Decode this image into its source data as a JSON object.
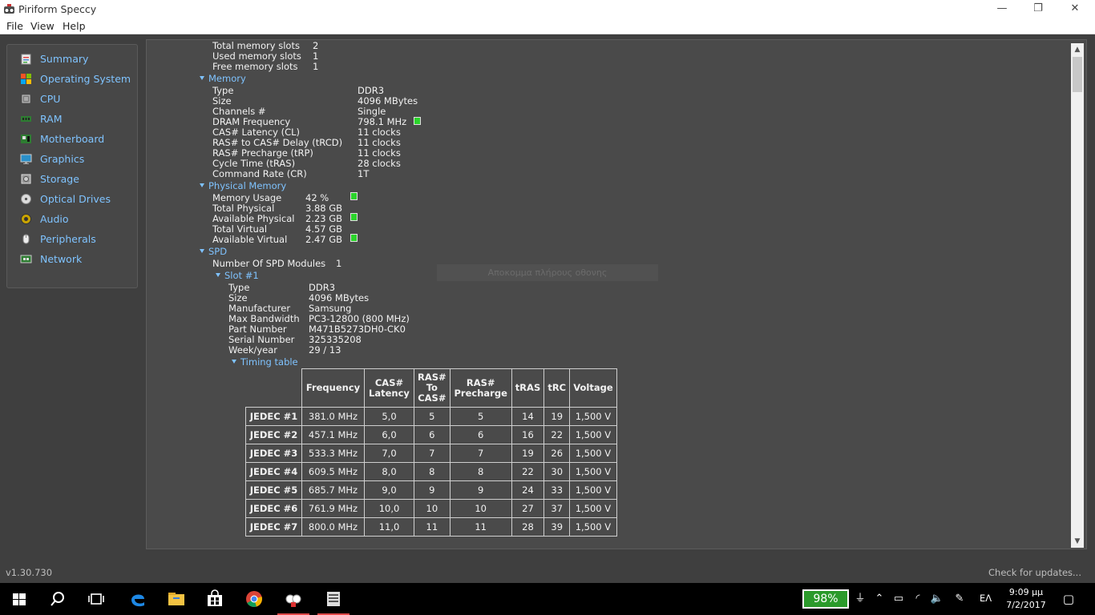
{
  "window": {
    "title": "Piriform Speccy",
    "minimize_glyph": "—",
    "restore_glyph": "❐",
    "close_glyph": "✕"
  },
  "menu": [
    "File",
    "View",
    "Help"
  ],
  "sidebar": {
    "items": [
      {
        "label": "Summary",
        "icon": "summary-icon"
      },
      {
        "label": "Operating System",
        "icon": "windows-logo-icon"
      },
      {
        "label": "CPU",
        "icon": "cpu-icon"
      },
      {
        "label": "RAM",
        "icon": "ram-icon"
      },
      {
        "label": "Motherboard",
        "icon": "motherboard-icon"
      },
      {
        "label": "Graphics",
        "icon": "monitor-icon"
      },
      {
        "label": "Storage",
        "icon": "hard-drive-icon"
      },
      {
        "label": "Optical Drives",
        "icon": "disc-icon"
      },
      {
        "label": "Audio",
        "icon": "speaker-icon"
      },
      {
        "label": "Peripherals",
        "icon": "mouse-icon"
      },
      {
        "label": "Network",
        "icon": "network-icon"
      }
    ]
  },
  "memory_slots": {
    "rows": [
      {
        "label": "Total memory slots",
        "value": "2"
      },
      {
        "label": "Used memory slots",
        "value": "1"
      },
      {
        "label": "Free memory slots",
        "value": "1"
      }
    ]
  },
  "memory": {
    "title": "Memory",
    "rows": [
      {
        "label": "Type",
        "value": "DDR3"
      },
      {
        "label": "Size",
        "value": "4096 MBytes"
      },
      {
        "label": "Channels #",
        "value": "Single"
      },
      {
        "label": "DRAM Frequency",
        "value": "798.1 MHz"
      },
      {
        "label": "CAS# Latency (CL)",
        "value": "11 clocks"
      },
      {
        "label": "RAS# to CAS# Delay (tRCD)",
        "value": "11 clocks"
      },
      {
        "label": "RAS# Precharge (tRP)",
        "value": "11 clocks"
      },
      {
        "label": "Cycle Time (tRAS)",
        "value": "28 clocks"
      },
      {
        "label": "Command Rate (CR)",
        "value": "1T"
      }
    ]
  },
  "physical_memory": {
    "title": "Physical Memory",
    "rows": [
      {
        "label": "Memory Usage",
        "value": "42 %"
      },
      {
        "label": "Total Physical",
        "value": "3.88 GB"
      },
      {
        "label": "Available Physical",
        "value": "2.23 GB"
      },
      {
        "label": "Total Virtual",
        "value": "4.57 GB"
      },
      {
        "label": "Available Virtual",
        "value": "2.47 GB"
      }
    ]
  },
  "spd": {
    "title": "SPD",
    "modules_label": "Number Of SPD Modules",
    "modules_value": "1",
    "slot_title": "Slot #1",
    "rows": [
      {
        "label": "Type",
        "value": "DDR3"
      },
      {
        "label": "Size",
        "value": "4096 MBytes"
      },
      {
        "label": "Manufacturer",
        "value": "Samsung"
      },
      {
        "label": "Max Bandwidth",
        "value": "PC3-12800 (800 MHz)"
      },
      {
        "label": "Part Number",
        "value": "M471B5273DH0-CK0"
      },
      {
        "label": "Serial Number",
        "value": "325335208"
      },
      {
        "label": "Week/year",
        "value": "29 / 13"
      }
    ],
    "timing_title": "Timing table",
    "timing_headers": [
      "Frequency",
      "CAS#\nLatency",
      "RAS#\nTo\nCAS#",
      "RAS#\nPrecharge",
      "tRAS",
      "tRC",
      "Voltage"
    ],
    "timing_rows": [
      [
        "JEDEC #1",
        "381.0 MHz",
        "5,0",
        "5",
        "5",
        "14",
        "19",
        "1,500 V"
      ],
      [
        "JEDEC #2",
        "457.1 MHz",
        "6,0",
        "6",
        "6",
        "16",
        "22",
        "1,500 V"
      ],
      [
        "JEDEC #3",
        "533.3 MHz",
        "7,0",
        "7",
        "7",
        "19",
        "26",
        "1,500 V"
      ],
      [
        "JEDEC #4",
        "609.5 MHz",
        "8,0",
        "8",
        "8",
        "22",
        "30",
        "1,500 V"
      ],
      [
        "JEDEC #5",
        "685.7 MHz",
        "9,0",
        "9",
        "9",
        "24",
        "33",
        "1,500 V"
      ],
      [
        "JEDEC #6",
        "761.9 MHz",
        "10,0",
        "10",
        "10",
        "27",
        "37",
        "1,500 V"
      ],
      [
        "JEDEC #7",
        "800.0 MHz",
        "11,0",
        "11",
        "11",
        "28",
        "39",
        "1,500 V"
      ]
    ]
  },
  "overlay_text": "Αποκομμα πλήρους οθονης",
  "status": {
    "version": "v1.30.730",
    "check_updates": "Check for updates..."
  },
  "taskbar": {
    "battery": "98%",
    "language": "ΕΛ",
    "time": "9:09 μμ",
    "date": "7/2/2017"
  },
  "colors": {
    "accent": "#7fc3ff",
    "indicator_green": "#2bd42b",
    "battery_green": "#2b9a2b"
  }
}
